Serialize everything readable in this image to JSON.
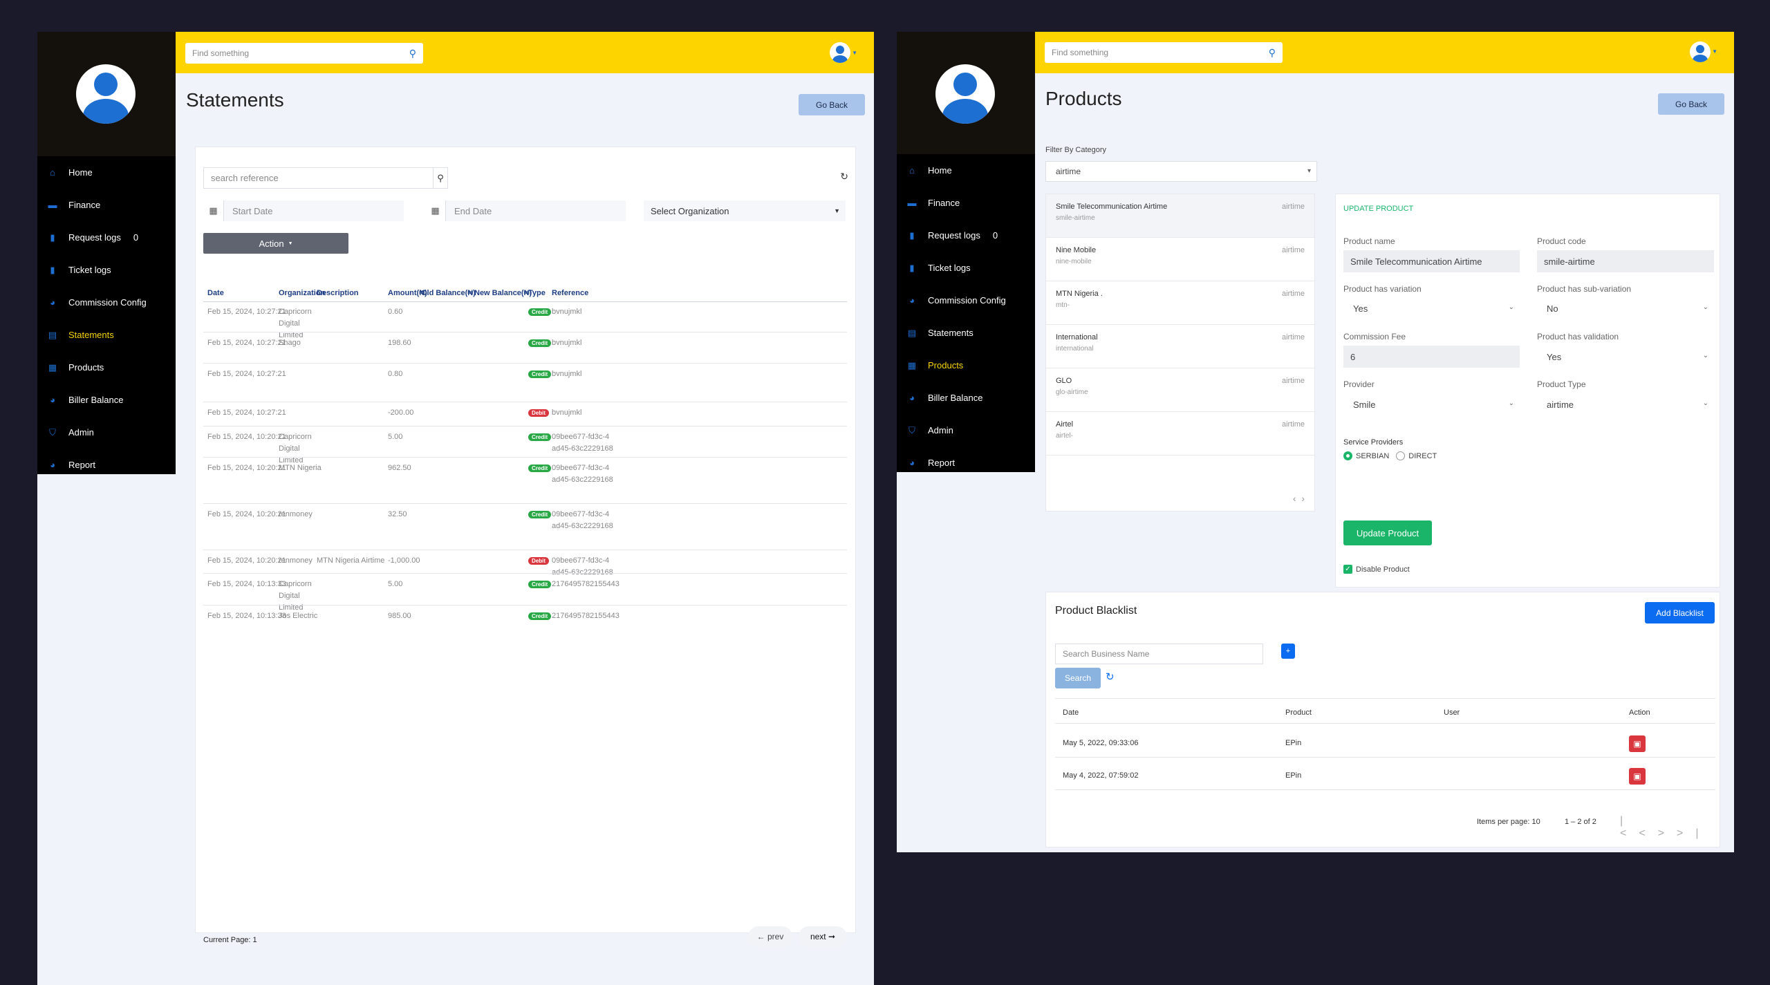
{
  "colors": {
    "accent_yellow": "#fdd400",
    "sidebar_bg": "#000000",
    "brand_blue": "#1d6fd1",
    "credit_green": "#28a745",
    "debit_red": "#d9363e",
    "update_green": "#1bb56a",
    "button_blue": "#0b6cf2"
  },
  "left": {
    "search": {
      "placeholder": "Find something",
      "icon": "search-icon"
    },
    "sidebar": {
      "items": [
        {
          "label": "Home",
          "icon": "home-icon"
        },
        {
          "label": "Finance",
          "icon": "card-icon"
        },
        {
          "label": "Request logs",
          "icon": "bar-chart-icon",
          "count": "0"
        },
        {
          "label": "Ticket logs",
          "icon": "bar-chart-icon"
        },
        {
          "label": "Commission Config",
          "icon": "pie-icon"
        },
        {
          "label": "Statements",
          "icon": "document-icon",
          "active": true
        },
        {
          "label": "Products",
          "icon": "box-icon"
        },
        {
          "label": "Biller Balance",
          "icon": "pie-icon"
        },
        {
          "label": "Admin",
          "icon": "shield-icon"
        },
        {
          "label": "Report",
          "icon": "pie-icon"
        }
      ]
    },
    "title": "Statements",
    "go_back": "Go Back",
    "filters": {
      "search_placeholder": "search reference",
      "start_date": "Start Date",
      "end_date": "End Date",
      "organization": "Select Organization",
      "action": "Action"
    },
    "table": {
      "headers": [
        "Date",
        "Organization",
        "Description",
        "Amount(₦)",
        "Old Balance(₦)",
        "New Balance(₦)",
        "Type",
        "Reference"
      ],
      "rows": [
        {
          "date": "Feb 15, 2024, 10:27:21",
          "org": "Capricorn\nDigital\nLimited",
          "desc": "",
          "amount": "0.60",
          "type": "Credit",
          "ref": "bvnujmkl"
        },
        {
          "date": "Feb 15, 2024, 10:27:21",
          "org": "Shago",
          "desc": "",
          "amount": "198.60",
          "type": "Credit",
          "ref": "bvnujmkl"
        },
        {
          "date": "Feb 15, 2024, 10:27:21",
          "org": "",
          "desc": "",
          "amount": "0.80",
          "type": "Credit",
          "ref": "bvnujmkl"
        },
        {
          "date": "Feb 15, 2024, 10:27:21",
          "org": "",
          "desc": "",
          "amount": "-200.00",
          "type": "Debit",
          "ref": "bvnujmkl"
        },
        {
          "date": "Feb 15, 2024, 10:20:21",
          "org": "Capricorn\nDigital\nLimited",
          "desc": "",
          "amount": "5.00",
          "type": "Credit",
          "ref": "09bee677-fd3c-4\nad45-63c2229168"
        },
        {
          "date": "Feb 15, 2024, 10:20:21",
          "org": "MTN Nigeria",
          "desc": "",
          "amount": "962.50",
          "type": "Credit",
          "ref": "09bee677-fd3c-4\nad45-63c2229168"
        },
        {
          "date": "Feb 15, 2024, 10:20:21",
          "org": "renmoney",
          "desc": "",
          "amount": "32.50",
          "type": "Credit",
          "ref": "09bee677-fd3c-4\nad45-63c2229168"
        },
        {
          "date": "Feb 15, 2024, 10:20:21",
          "org": "renmoney",
          "desc": "MTN Nigeria Airtime",
          "amount": "-1,000.00",
          "type": "Debit",
          "ref": "09bee677-fd3c-4\nad45-63c2229168"
        },
        {
          "date": "Feb 15, 2024, 10:13:33",
          "org": "Capricorn\nDigital\nLimited",
          "desc": "",
          "amount": "5.00",
          "type": "Credit",
          "ref": "2176495782155443"
        },
        {
          "date": "Feb 15, 2024, 10:13:33",
          "org": "Jos Electric",
          "desc": "",
          "amount": "985.00",
          "type": "Credit",
          "ref": "2176495782155443"
        }
      ]
    },
    "pager": {
      "current": "Current Page: 1",
      "prev": "← prev",
      "next": "next ➞"
    }
  },
  "right": {
    "search": {
      "placeholder": "Find something"
    },
    "sidebar": {
      "items": [
        {
          "label": "Home",
          "icon": "home-icon"
        },
        {
          "label": "Finance",
          "icon": "card-icon"
        },
        {
          "label": "Request logs",
          "icon": "bar-chart-icon",
          "count": "0"
        },
        {
          "label": "Ticket logs",
          "icon": "bar-chart-icon"
        },
        {
          "label": "Commission Config",
          "icon": "pie-icon"
        },
        {
          "label": "Statements",
          "icon": "document-icon"
        },
        {
          "label": "Products",
          "icon": "box-icon",
          "active": true
        },
        {
          "label": "Biller Balance",
          "icon": "pie-icon"
        },
        {
          "label": "Admin",
          "icon": "shield-icon"
        },
        {
          "label": "Report",
          "icon": "pie-icon"
        }
      ]
    },
    "title": "Products",
    "go_back": "Go Back",
    "filter_label": "Filter By Category",
    "filter_value": "airtime",
    "products": [
      {
        "name": "Smile Telecommunication Airtime",
        "code": "smile-airtime",
        "cat": "airtime"
      },
      {
        "name": "Nine Mobile",
        "code": "nine-mobile",
        "cat": "airtime"
      },
      {
        "name": "MTN Nigeria .",
        "code": "mtn-",
        "cat": "airtime"
      },
      {
        "name": "International",
        "code": "international",
        "cat": "airtime"
      },
      {
        "name": "GLO",
        "code": "glo-airtime",
        "cat": "airtime"
      },
      {
        "name": "Airtel",
        "code": "airtel-",
        "cat": "airtime"
      }
    ],
    "update": {
      "heading": "UPDATE PRODUCT",
      "product_name_label": "Product name",
      "product_name": "Smile Telecommunication Airtime",
      "product_code_label": "Product code",
      "product_code": "smile-airtime",
      "variation_label": "Product has variation",
      "variation": "Yes",
      "subvariation_label": "Product has sub-variation",
      "subvariation": "No",
      "fee_label": "Commission Fee",
      "fee": "6",
      "validation_label": "Product has validation",
      "validation": "Yes",
      "provider_label": "Provider",
      "provider": "Smile",
      "type_label": "Product Type",
      "type": "airtime",
      "service_label": "Service Providers",
      "sp1": "SERBIAN",
      "sp2": "DIRECT",
      "button": "Update Product",
      "disable": "Disable Product"
    },
    "blacklist": {
      "title": "Product Blacklist",
      "add": "Add Blacklist",
      "search_placeholder": "Search Business Name",
      "search": "Search",
      "headers": [
        "Date",
        "Product",
        "User",
        "Action"
      ],
      "rows": [
        {
          "date": "May 5, 2022, 09:33:06",
          "product": "EPin",
          "user": ""
        },
        {
          "date": "May 4, 2022, 07:59:02",
          "product": "EPin",
          "user": ""
        }
      ],
      "items_per_page": "Items per page: 10",
      "range": "1 – 2 of 2"
    }
  }
}
